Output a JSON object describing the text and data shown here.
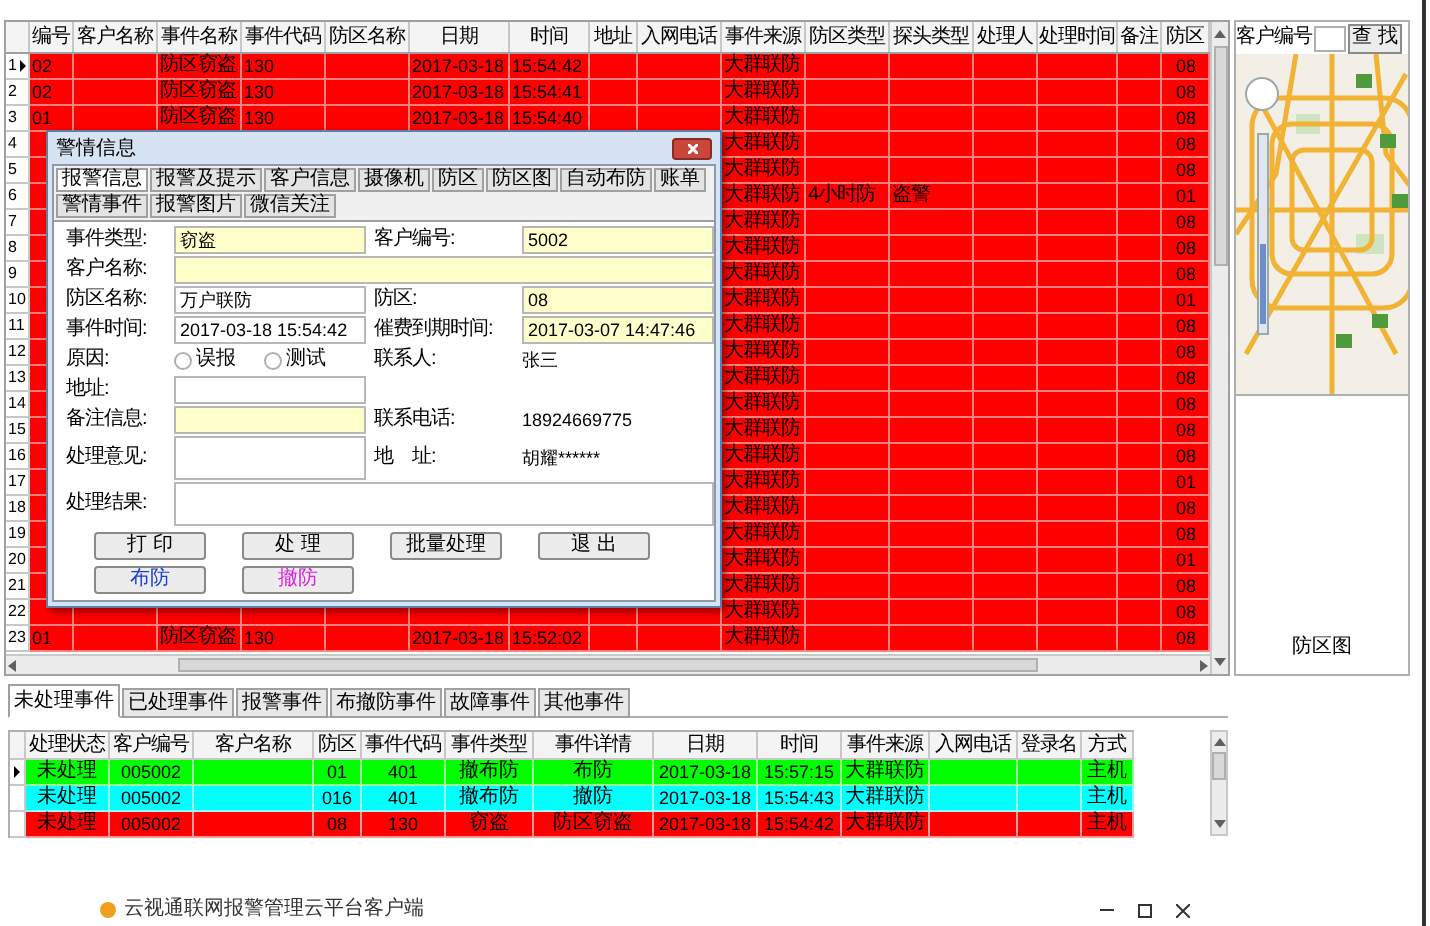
{
  "grid": {
    "columns": [
      "编号",
      "客户名称",
      "事件名称",
      "事件代码",
      "防区名称",
      "日期",
      "时间",
      "地址",
      "入网电话",
      "事件来源",
      "防区类型",
      "探头类型",
      "处理人",
      "处理时间",
      "备注",
      "防区"
    ],
    "rows": [
      {
        "number": "1",
        "selected": true,
        "cells": {
          "id": "02",
          "event_name": "防区窃盗",
          "event_code": "130",
          "date": "2017-03-18",
          "time": "15:54:42",
          "event_source": "大群联防",
          "zone": "08"
        }
      },
      {
        "number": "2",
        "selected": false,
        "cells": {
          "id": "02",
          "event_name": "防区窃盗",
          "event_code": "130",
          "date": "2017-03-18",
          "time": "15:54:41",
          "event_source": "大群联防",
          "zone": "08"
        }
      },
      {
        "number": "3",
        "selected": false,
        "cells": {
          "id": "01",
          "event_name": "防区窃盗",
          "event_code": "130",
          "date": "2017-03-18",
          "time": "15:54:40",
          "event_source": "大群联防",
          "zone": "08"
        }
      },
      {
        "number": "4",
        "selected": false,
        "cells": {
          "event_source": "大群联防",
          "zone": "08"
        }
      },
      {
        "number": "5",
        "selected": false,
        "cells": {
          "event_source": "大群联防",
          "zone": "08"
        }
      },
      {
        "number": "6",
        "selected": false,
        "cells": {
          "event_source": "大群联防",
          "zone_type": "4小时防",
          "probe_type": "盗警",
          "zone": "01"
        }
      },
      {
        "number": "7",
        "selected": false,
        "cells": {
          "event_source": "大群联防",
          "zone": "08"
        }
      },
      {
        "number": "8",
        "selected": false,
        "cells": {
          "event_source": "大群联防",
          "zone": "08"
        }
      },
      {
        "number": "9",
        "selected": false,
        "cells": {
          "event_source": "大群联防",
          "zone": "08"
        }
      },
      {
        "number": "10",
        "selected": false,
        "cells": {
          "event_source": "大群联防",
          "zone": "01"
        }
      },
      {
        "number": "11",
        "selected": false,
        "cells": {
          "event_source": "大群联防",
          "zone": "08"
        }
      },
      {
        "number": "12",
        "selected": false,
        "cells": {
          "event_source": "大群联防",
          "zone": "08"
        }
      },
      {
        "number": "13",
        "selected": false,
        "cells": {
          "event_source": "大群联防",
          "zone": "08"
        }
      },
      {
        "number": "14",
        "selected": false,
        "cells": {
          "event_source": "大群联防",
          "zone": "08"
        }
      },
      {
        "number": "15",
        "selected": false,
        "cells": {
          "event_source": "大群联防",
          "zone": "08"
        }
      },
      {
        "number": "16",
        "selected": false,
        "cells": {
          "event_source": "大群联防",
          "zone": "08"
        }
      },
      {
        "number": "17",
        "selected": false,
        "cells": {
          "event_source": "大群联防",
          "zone": "01"
        }
      },
      {
        "number": "18",
        "selected": false,
        "cells": {
          "event_source": "大群联防",
          "zone": "08"
        }
      },
      {
        "number": "19",
        "selected": false,
        "cells": {
          "event_source": "大群联防",
          "zone": "08"
        }
      },
      {
        "number": "20",
        "selected": false,
        "cells": {
          "event_source": "大群联防",
          "zone": "01"
        }
      },
      {
        "number": "21",
        "selected": false,
        "cells": {
          "event_source": "大群联防",
          "zone": "08"
        }
      },
      {
        "number": "22",
        "selected": false,
        "cells": {
          "event_source": "大群联防",
          "zone": "08"
        }
      },
      {
        "number": "23",
        "selected": false,
        "cells": {
          "id": "01",
          "event_name": "防区窃盗",
          "event_code": "130",
          "date": "2017-03-18",
          "time": "15:52:02",
          "event_source": "大群联防",
          "zone": "08"
        }
      }
    ]
  },
  "dialog": {
    "title": "警情信息",
    "tabs": [
      {
        "label": "报警信息",
        "selected": true
      },
      {
        "label": "报警及提示",
        "selected": false
      },
      {
        "label": "客户信息",
        "selected": false
      },
      {
        "label": "摄像机",
        "selected": false
      },
      {
        "label": "防区",
        "selected": false
      },
      {
        "label": "防区图",
        "selected": false
      },
      {
        "label": "自动布防",
        "selected": false
      },
      {
        "label": "账单",
        "selected": false
      },
      {
        "label": "警情事件",
        "selected": false
      },
      {
        "label": "报警图片",
        "selected": false
      },
      {
        "label": "微信关注",
        "selected": false
      }
    ],
    "form": [
      {
        "left": {
          "kind": "field",
          "label": "事件类型:",
          "value": "窃盗",
          "highlighted": true
        },
        "right": {
          "kind": "field",
          "label": "客户编号:",
          "value": "5002",
          "highlighted": true
        }
      },
      {
        "left": {
          "kind": "wide_field",
          "label": "客户名称:",
          "highlighted": true
        }
      },
      {
        "left": {
          "kind": "field",
          "label": "防区名称:",
          "value": "万户联防",
          "highlighted": false
        },
        "right": {
          "kind": "field",
          "label": "防区:",
          "value": "08",
          "highlighted": true
        }
      },
      {
        "left": {
          "kind": "field",
          "label": "事件时间:",
          "value": "2017-03-18 15:54:42",
          "highlighted": false
        },
        "right": {
          "kind": "field",
          "label": "催费到期时间:",
          "value": "2017-03-07 14:47:46",
          "highlighted": true
        }
      },
      {
        "left": {
          "kind": "radios",
          "label": "原因:",
          "options": [
            {
              "label": "误报",
              "checked": false
            },
            {
              "label": "测试",
              "checked": false
            }
          ]
        },
        "right": {
          "kind": "plain",
          "label": "联系人:",
          "value": "张三"
        }
      },
      {
        "left": {
          "kind": "field",
          "label": "地址:",
          "highlighted": false
        }
      },
      {
        "left": {
          "kind": "field",
          "label": "备注信息:",
          "highlighted": true
        },
        "right": {
          "kind": "plain",
          "label": "联系电话:",
          "value": "18924669775"
        }
      },
      {
        "left": {
          "kind": "area",
          "label": "处理意见:"
        },
        "right": {
          "kind": "plain",
          "label": "地　址:",
          "value": "胡耀******"
        }
      },
      {
        "left": {
          "kind": "wide_area",
          "label": "处理结果:"
        }
      }
    ],
    "buttons": [
      {
        "label": "打 印"
      },
      {
        "label": "处 理"
      },
      {
        "label": "批量处理"
      },
      {
        "label": "退 出"
      }
    ],
    "arm_buttons": [
      {
        "label": "布防",
        "kind": "arm"
      },
      {
        "label": "撤防",
        "kind": "disarm"
      }
    ]
  },
  "search": {
    "label": "客户编号",
    "button": "查 找"
  },
  "zone_map": {
    "label": "防区图"
  },
  "event_tabs": [
    {
      "label": "未处理事件",
      "selected": true
    },
    {
      "label": "已处理事件",
      "selected": false
    },
    {
      "label": "报警事件",
      "selected": false
    },
    {
      "label": "布撤防事件",
      "selected": false
    },
    {
      "label": "故障事件",
      "selected": false
    },
    {
      "label": "其他事件",
      "selected": false
    }
  ],
  "events": {
    "columns": [
      "处理状态",
      "客户编号",
      "客户名称",
      "防区",
      "事件代码",
      "事件类型",
      "事件详情",
      "日期",
      "时间",
      "事件来源",
      "入网电话",
      "登录名",
      "方式"
    ],
    "rows": [
      {
        "selected": true,
        "color": "#00ff00",
        "cells": [
          "未处理",
          "005002",
          "",
          "01",
          "401",
          "撤布防",
          "布防",
          "2017-03-18",
          "15:57:15",
          "大群联防",
          "",
          "",
          "主机"
        ]
      },
      {
        "selected": false,
        "color": "#00ffff",
        "cells": [
          "未处理",
          "005002",
          "",
          "016",
          "401",
          "撤布防",
          "撤防",
          "2017-03-18",
          "15:54:43",
          "大群联防",
          "",
          "",
          "主机"
        ]
      },
      {
        "selected": false,
        "color": "#ff0000",
        "cells": [
          "未处理",
          "005002",
          "",
          "08",
          "130",
          "窃盗",
          "防区窃盗",
          "2017-03-18",
          "15:54:42",
          "大群联防",
          "",
          "",
          "主机"
        ]
      }
    ]
  },
  "taskbar": {
    "title": "云视通联网报警管理云平台客户端"
  }
}
